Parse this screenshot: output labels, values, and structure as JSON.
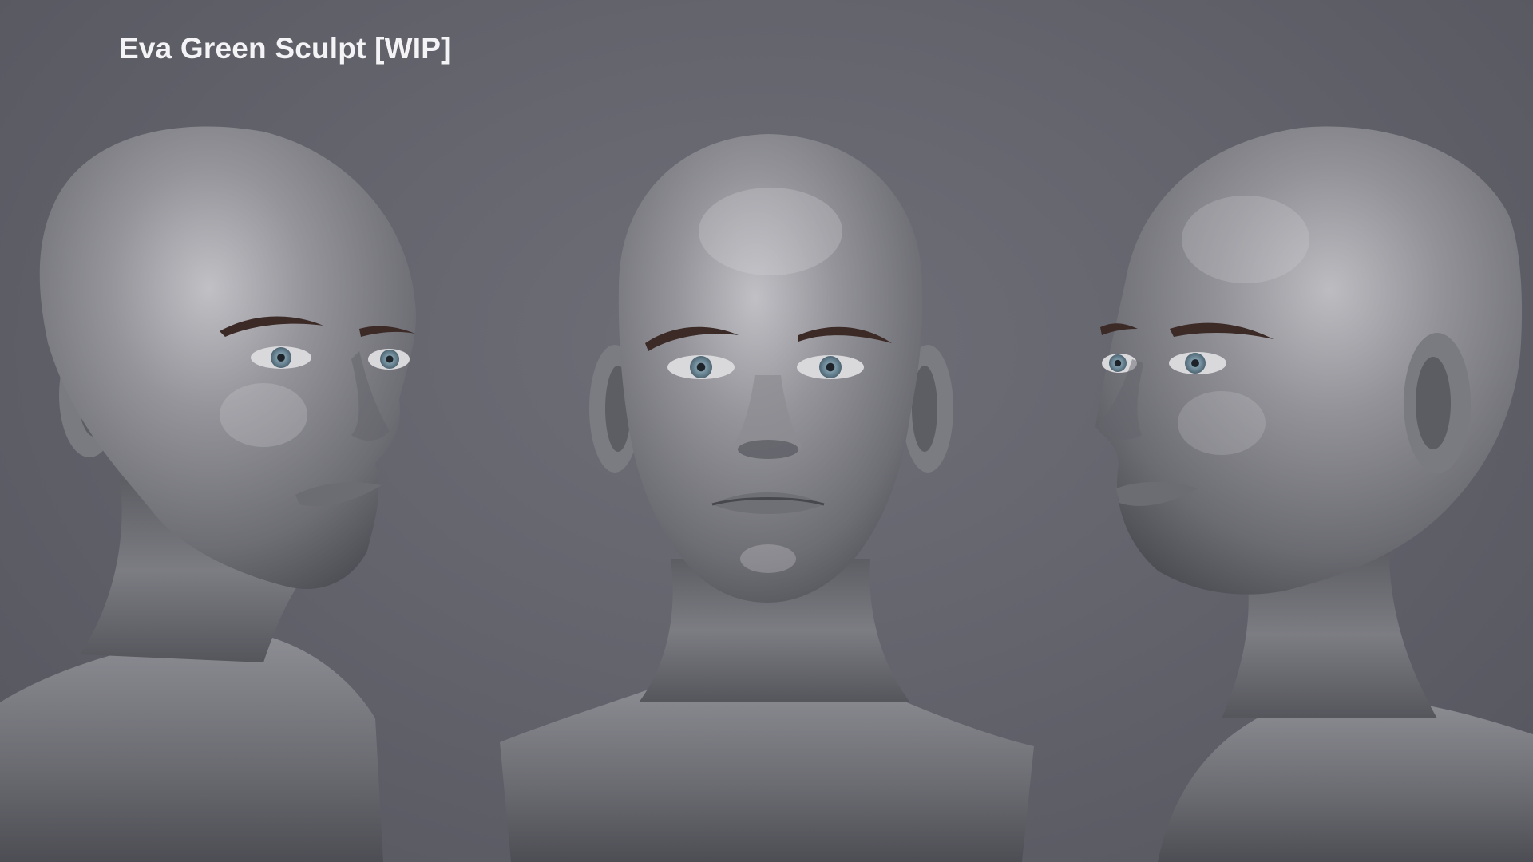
{
  "title": "Eva Green Sculpt [WIP]",
  "views": [
    {
      "name": "three-quarter-left"
    },
    {
      "name": "front"
    },
    {
      "name": "three-quarter-right"
    }
  ],
  "colors": {
    "background": "#64646d",
    "clay": "#8a8a90",
    "clay_highlight": "#c4c4c8",
    "clay_shadow": "#3a3a40",
    "brow": "#3b2a26",
    "iris": "#6f8a99",
    "title_text": "#f4f4f6"
  }
}
